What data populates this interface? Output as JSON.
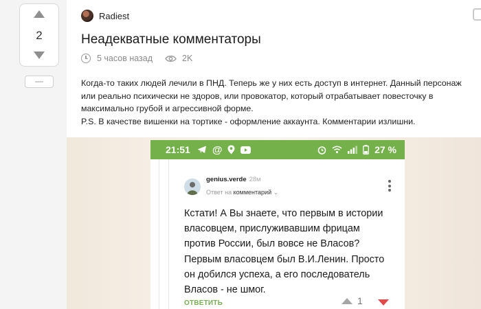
{
  "rating": {
    "count": "2",
    "collapse_label": "—"
  },
  "post": {
    "author": "Radiest",
    "title": "Неадекватные комментаторы",
    "time": "5 часов назад",
    "views": "2K",
    "body": [
      "Когда-то таких людей лечили в ПНД. Теперь же у них есть доступ в интернет. Данный персонаж или реально психически не здоров, или провокатор, который отрабатывает повесточку в максимально грубой и агрессивной форме.",
      "P.S. В качестве вишенки на тортике - оформление аккаунта. Комментарии излишни."
    ]
  },
  "screenshot": {
    "status_time": "21:51",
    "battery": "27 %",
    "statusbar_color": "#74b14a",
    "comment": {
      "user": "genius.verde",
      "age": "28м",
      "reply_prefix": "Ответ на",
      "reply_target": "комментарий",
      "text": "Кстати! А Вы знаете, что первым в истории власовцем, прислуживавшим фрицам против России, был вовсе не Власов? Первым власовцем был В.И.Ленин. Просто он добился успеха, а его последователь Власов - не шмог.",
      "answer_label": "ОТВЕТИТЬ",
      "rating": "1"
    }
  },
  "colors": {
    "accent_green": "#79ae52",
    "downvote_red": "#e04a4a"
  }
}
